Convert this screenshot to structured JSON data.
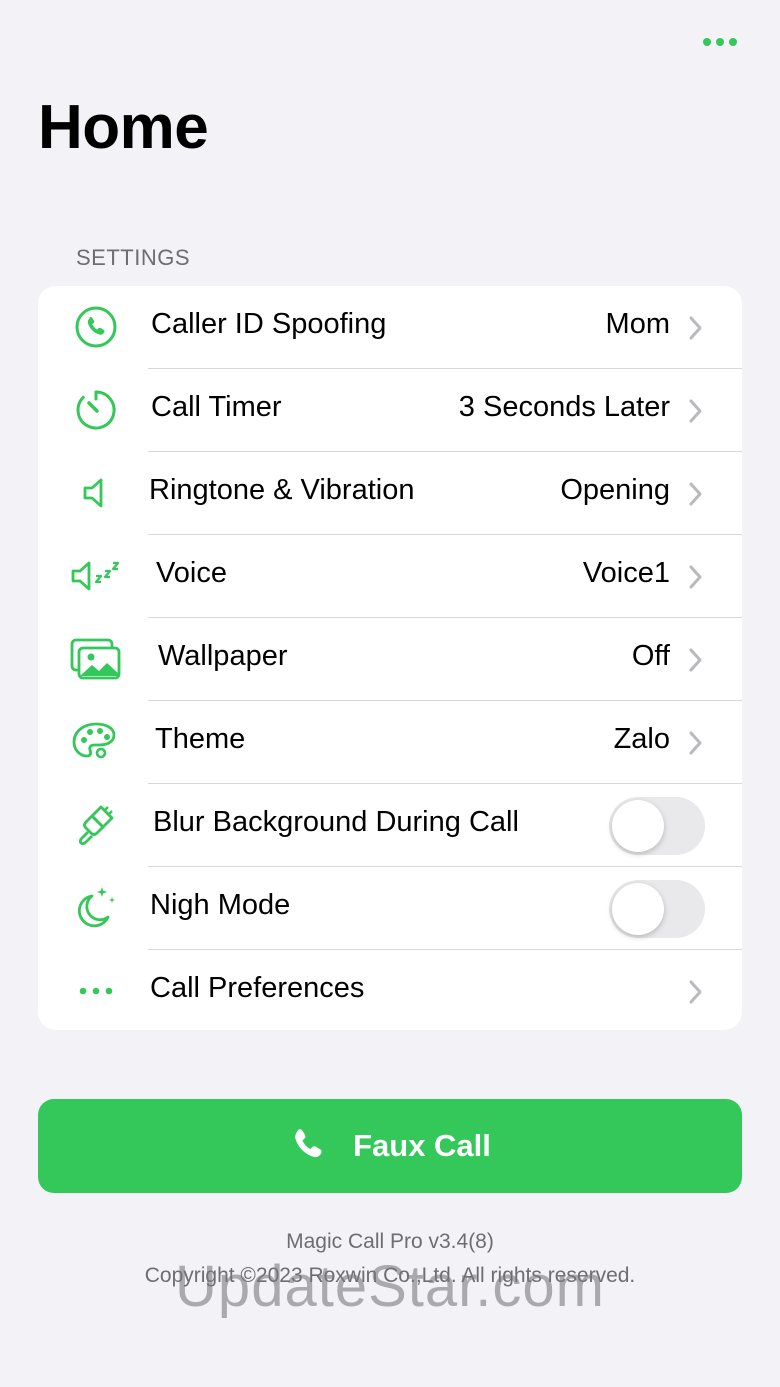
{
  "header": {
    "title": "Home"
  },
  "settings": {
    "section_title": "SETTINGS",
    "rows": [
      {
        "label": "Caller ID Spoofing",
        "value": "Mom",
        "icon": "phone-icon"
      },
      {
        "label": "Call Timer",
        "value": "3 Seconds Later",
        "icon": "timer-icon"
      },
      {
        "label": "Ringtone & Vibration",
        "value": "Opening",
        "icon": "speaker-icon"
      },
      {
        "label": "Voice",
        "value": "Voice1",
        "icon": "speaker-zzz-icon"
      },
      {
        "label": "Wallpaper",
        "value": "Off",
        "icon": "photos-icon"
      },
      {
        "label": "Theme",
        "value": "Zalo",
        "icon": "palette-icon"
      },
      {
        "label": "Blur Background During Call",
        "toggle": false,
        "icon": "paintbrush-icon"
      },
      {
        "label": "Nigh Mode",
        "toggle": false,
        "icon": "moon-stars-icon"
      },
      {
        "label": "Call Preferences",
        "icon": "ellipsis-icon"
      }
    ]
  },
  "call_button": {
    "label": "Faux Call",
    "icon": "phone-icon"
  },
  "footer": {
    "version": "Magic Call Pro v3.4(8)",
    "copyright": "Copyright ©2023 Roxwin Co.,Ltd. All rights reserved."
  },
  "watermark": "UpdateStar.com",
  "colors": {
    "accent": "#34c759",
    "background": "#f2f2f7",
    "card": "#ffffff",
    "secondary_text": "#6d6d72",
    "toggle_off": "#e9e9eb"
  }
}
